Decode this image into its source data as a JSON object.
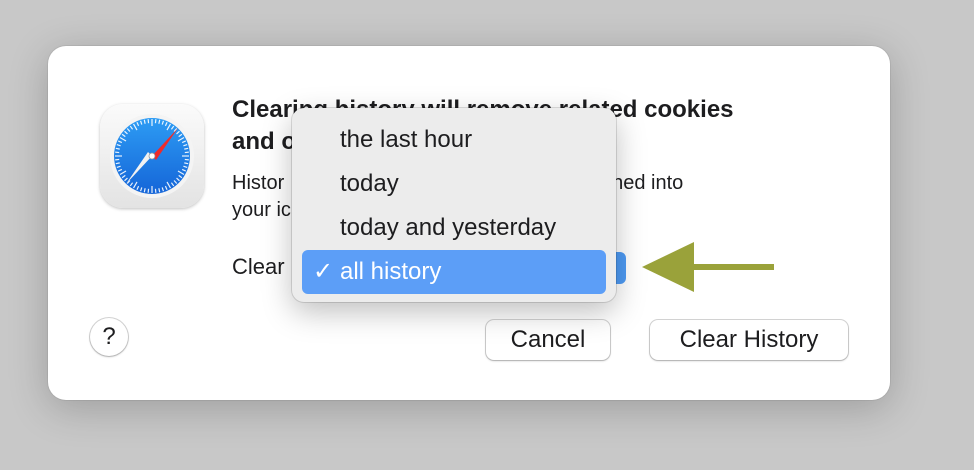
{
  "dialog": {
    "title_line1": "Clearing history will remove related cookies",
    "title_line2": "and o",
    "body_line1": "Histor                                       r devices signed into",
    "body_line2": "your ic",
    "clear_label": "Clear",
    "help_label": "?",
    "cancel_label": "Cancel",
    "clear_history_label": "Clear History",
    "app_icon": "safari-compass-icon"
  },
  "menu": {
    "items": [
      {
        "label": "the last hour",
        "checked": false
      },
      {
        "label": "today",
        "checked": false
      },
      {
        "label": "today and yesterday",
        "checked": false
      },
      {
        "label": "all history",
        "checked": true
      }
    ],
    "check_glyph": "✓"
  },
  "annotation": {
    "arrow_color": "#9aa23a",
    "direction": "left"
  },
  "colors": {
    "selection": "#5c9ef7",
    "background": "#c8c8c8"
  }
}
